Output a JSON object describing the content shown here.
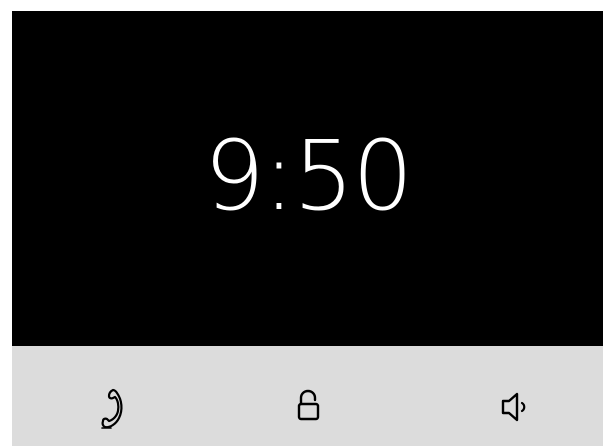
{
  "display": {
    "time": "9:50"
  },
  "controls": {
    "call": {
      "icon": "phone-icon"
    },
    "unlock": {
      "icon": "unlock-icon"
    },
    "volume": {
      "icon": "speaker-icon"
    }
  },
  "colors": {
    "display_background": "#000000",
    "clock_text": "#ffffff",
    "control_bar": "#dcdcdc",
    "icon_stroke": "#000000"
  }
}
